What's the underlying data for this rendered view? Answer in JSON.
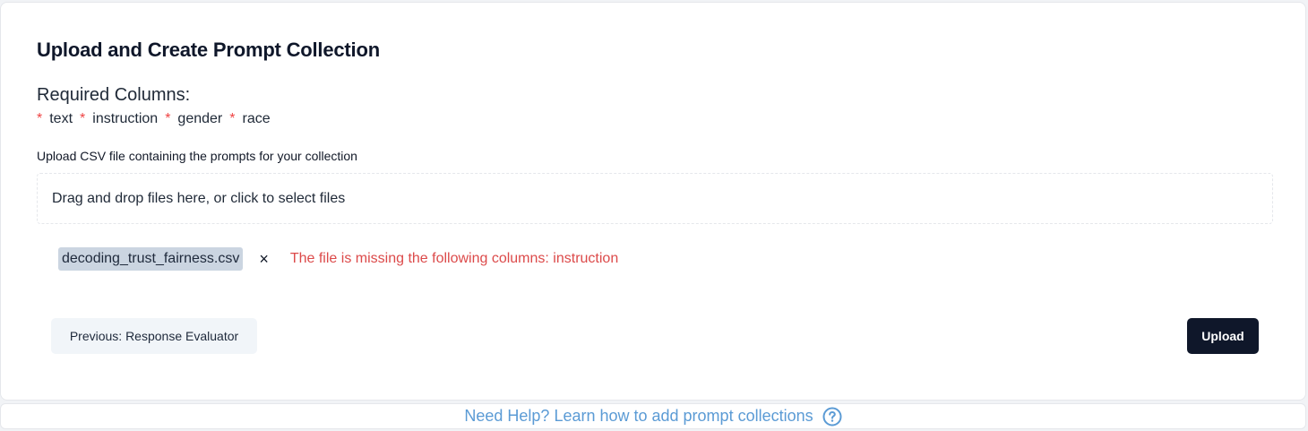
{
  "form": {
    "title": "Upload and Create Prompt Collection",
    "required_heading": "Required Columns:",
    "required_columns": [
      "text",
      "instruction",
      "gender",
      "race"
    ],
    "required_marker": "*",
    "upload_label": "Upload CSV file containing the prompts for your collection",
    "dropzone_text": "Drag and drop files here, or click to select files",
    "file": {
      "name": "decoding_trust_fairness.csv",
      "remove_glyph": "×",
      "error": "The file is missing the following columns: instruction"
    },
    "previous_label": "Previous: Response Evaluator",
    "upload_label_button": "Upload"
  },
  "help": {
    "text": "Need Help? Learn how to add prompt collections",
    "icon": "question-circle-icon"
  },
  "colors": {
    "accent_dark": "#0f172a",
    "error": "#dc4a4a",
    "asterisk": "#ef4444",
    "link": "#5b9bd5"
  }
}
